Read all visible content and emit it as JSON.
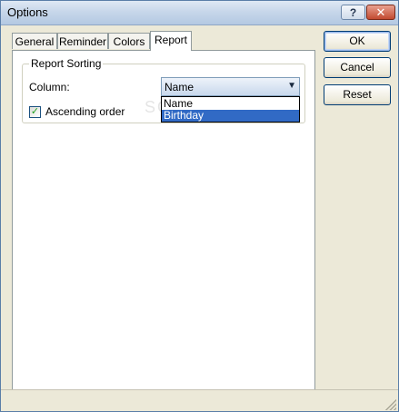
{
  "window": {
    "title": "Options",
    "help_glyph": "?",
    "close_glyph": "✕"
  },
  "tabs": [
    {
      "label": "General"
    },
    {
      "label": "Reminder"
    },
    {
      "label": "Colors"
    },
    {
      "label": "Report"
    }
  ],
  "active_tab": "Report",
  "report": {
    "group_title": "Report Sorting",
    "column_label": "Column:",
    "column_selected": "Name",
    "column_options": [
      "Name",
      "Birthday"
    ],
    "highlighted_option": "Birthday",
    "ascending_label": "Ascending order",
    "ascending_checked": true
  },
  "buttons": {
    "ok": "OK",
    "cancel": "Cancel",
    "reset": "Reset"
  },
  "icons": {
    "dropdown": "chevron-down-icon",
    "check": "checkmark-icon",
    "help": "help-icon",
    "close": "close-icon"
  },
  "colors": {
    "selection": "#316ac5",
    "face": "#ece9d8"
  },
  "watermark": "SOFTPEDIA"
}
